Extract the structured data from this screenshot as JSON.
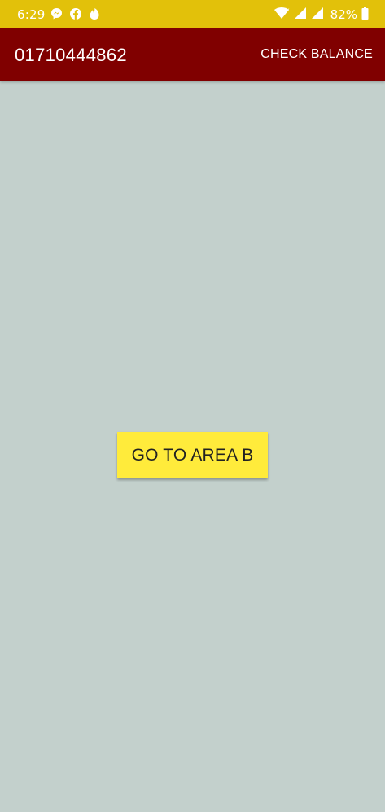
{
  "status_bar": {
    "time": "6:29",
    "left_icons": [
      "messenger-icon",
      "facebook-icon",
      "tinder-icon"
    ],
    "right_icons": [
      "wifi-icon",
      "signal-icon",
      "signal-icon"
    ],
    "battery": "82%"
  },
  "app_bar": {
    "title": "01710444862",
    "action_label": "CHECK BALANCE"
  },
  "main": {
    "button_label": "GO TO AREA B"
  },
  "colors": {
    "status_bar": "#e2c10a",
    "app_bar": "#800000",
    "background": "#c3d0cc",
    "button": "#ffeb3b"
  }
}
